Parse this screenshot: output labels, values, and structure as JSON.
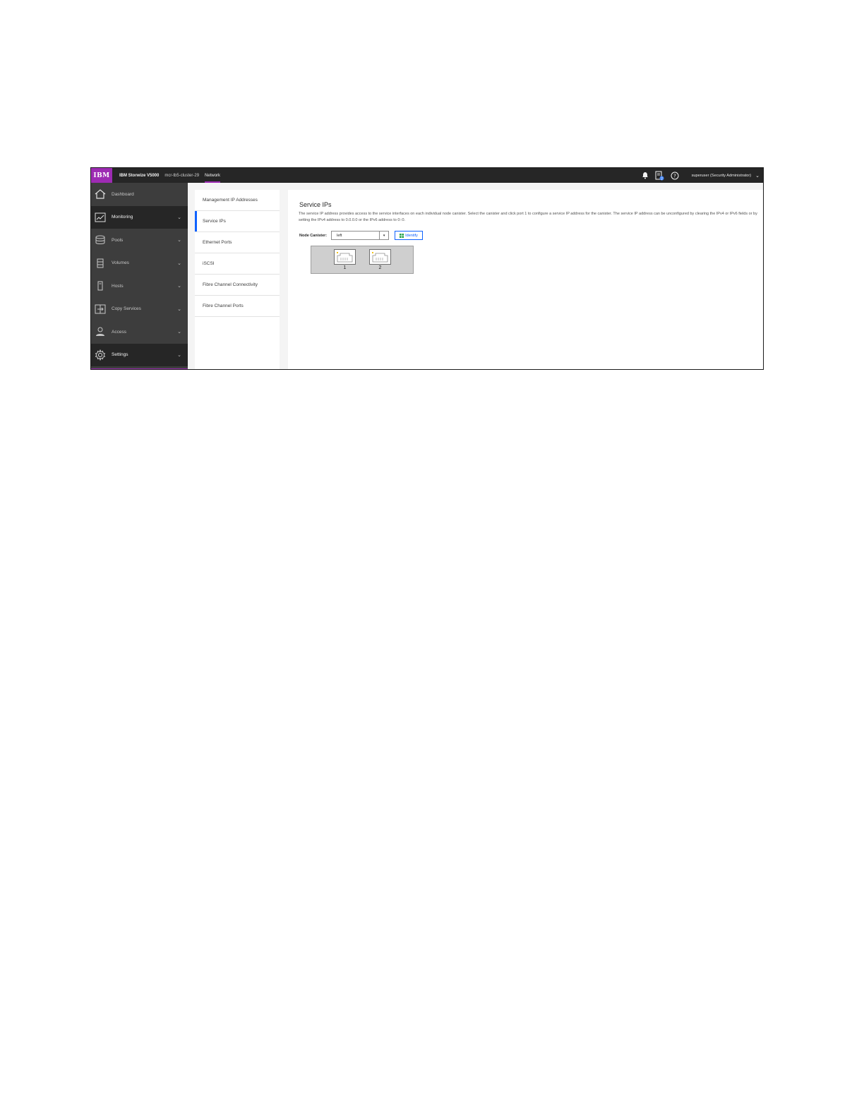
{
  "topbar": {
    "logo": "IBM",
    "product": "IBM Storwize V5000",
    "cluster": "mcr-tb5-cluster-29",
    "breadcrumb": "Network",
    "user": "superuser (Security Administrator)",
    "icons": [
      "bell-icon",
      "tasks-icon",
      "help-icon",
      "chevron-down-icon"
    ]
  },
  "sidebar": {
    "items": [
      {
        "label": "Dashboard",
        "icon": "home-icon",
        "has_chevron": false
      },
      {
        "label": "Monitoring",
        "icon": "monitoring-icon",
        "has_chevron": true
      },
      {
        "label": "Pools",
        "icon": "pools-icon",
        "has_chevron": true
      },
      {
        "label": "Volumes",
        "icon": "volumes-icon",
        "has_chevron": true
      },
      {
        "label": "Hosts",
        "icon": "hosts-icon",
        "has_chevron": true
      },
      {
        "label": "Copy Services",
        "icon": "copy-services-icon",
        "has_chevron": true
      },
      {
        "label": "Access",
        "icon": "access-icon",
        "has_chevron": true
      },
      {
        "label": "Settings",
        "icon": "settings-icon",
        "has_chevron": true
      }
    ]
  },
  "subnav": {
    "items": [
      {
        "label": "Management IP Addresses"
      },
      {
        "label": "Service IPs"
      },
      {
        "label": "Ethernet Ports"
      },
      {
        "label": "iSCSI"
      },
      {
        "label": "Fibre Channel Connectivity"
      },
      {
        "label": "Fibre Channel Ports"
      }
    ]
  },
  "main": {
    "title": "Service IPs",
    "description": "The service IP address provides access to the service interfaces on each individual node canister. Select the canister and click port 1 to configure a service IP address for the canister. The service IP address can be unconfigured by clearing the IPv4 or IPv6 fields or by setting the IPv4 address to 0.0.0.0 or the IPv6 address to 0::0.",
    "node_canister_label": "Node Canister:",
    "node_canister_value": "left",
    "identify_label": "Identify",
    "ports": [
      {
        "number": "1"
      },
      {
        "number": "2"
      }
    ]
  },
  "colors": {
    "accent": "#9d2bb3",
    "topbar": "#262626",
    "sidebar": "#3d3d3d",
    "link": "#0f62fe"
  }
}
